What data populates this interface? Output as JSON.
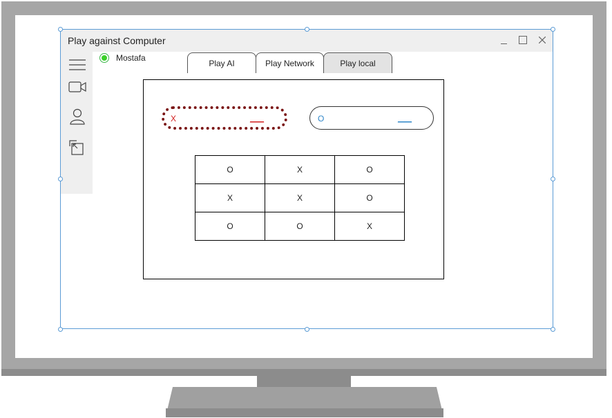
{
  "window": {
    "title": "Play against Computer"
  },
  "sidebar": {
    "icons": [
      "menu-icon",
      "video-camera-icon",
      "user-icon",
      "logout-icon"
    ]
  },
  "user": {
    "name": "Mostafa",
    "status": "online"
  },
  "tabs": [
    {
      "label": "Play AI"
    },
    {
      "label": "Play Network"
    },
    {
      "label": "Play local",
      "selected": true
    }
  ],
  "players": {
    "x": {
      "symbol": "X",
      "value": "___",
      "color": "#d21f1f"
    },
    "o": {
      "symbol": "O",
      "value": "___",
      "color": "#2e86c8"
    }
  },
  "board": [
    [
      "O",
      "X",
      "O"
    ],
    [
      "X",
      "X",
      "O"
    ],
    [
      "O",
      "O",
      "X"
    ]
  ]
}
